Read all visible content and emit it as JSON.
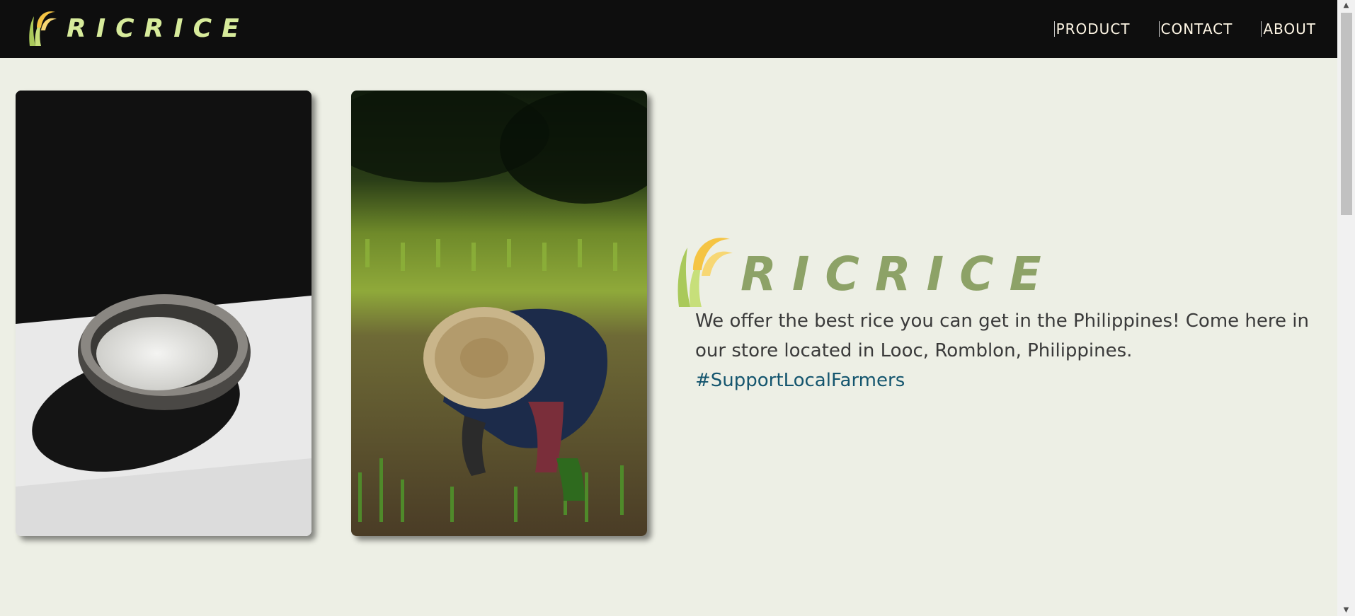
{
  "header": {
    "brand": "RICRICE",
    "nav": [
      {
        "label": "PRODUCT"
      },
      {
        "label": "CONTACT"
      },
      {
        "label": "ABOUT"
      }
    ]
  },
  "main": {
    "hero_brand": "RICRICE",
    "description": "We offer the best rice you can get in the Philippines! Come here in our store located in Looc, Romblon, Philippines.",
    "hashtag": "#SupportLocalFarmers"
  },
  "colors": {
    "background": "#edefe5",
    "topbar": "#0e0e0e",
    "brand_green": "#8da267",
    "logo_yellow": "#f5c443",
    "hashtag_blue": "#14556e"
  }
}
